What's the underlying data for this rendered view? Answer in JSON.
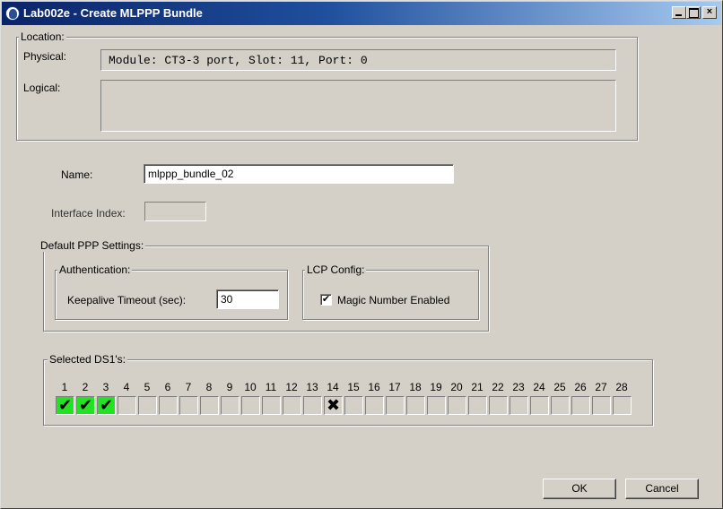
{
  "window": {
    "title": "Lab002e - Create MLPPP Bundle",
    "controls": {
      "minimize": "",
      "maximize": "",
      "close": "×"
    }
  },
  "location": {
    "group_label": "Location:",
    "physical_label": "Physical:",
    "physical_value": "Module: CT3-3 port, Slot: 11, Port: 0",
    "logical_label": "Logical:",
    "logical_value": ""
  },
  "form": {
    "name_label": "Name:",
    "name_value": "mlppp_bundle_02",
    "interface_index_label": "Interface Index:",
    "interface_index_value": ""
  },
  "ppp": {
    "group_label": "Default PPP Settings:",
    "auth": {
      "group_label": "Authentication:",
      "keepalive_label": "Keepalive Timeout (sec):",
      "keepalive_value": "30"
    },
    "lcp": {
      "group_label": "LCP Config:",
      "magic_label": "Magic Number Enabled",
      "magic_mark": "✔",
      "magic_checked": true
    }
  },
  "ds1": {
    "group_label": "Selected DS1's:",
    "channels": [
      {
        "num": "1",
        "state": "selected",
        "mark": "✔"
      },
      {
        "num": "2",
        "state": "selected",
        "mark": "✔"
      },
      {
        "num": "3",
        "state": "selected",
        "mark": "✔"
      },
      {
        "num": "4",
        "state": "empty",
        "mark": ""
      },
      {
        "num": "5",
        "state": "empty",
        "mark": ""
      },
      {
        "num": "6",
        "state": "empty",
        "mark": ""
      },
      {
        "num": "7",
        "state": "empty",
        "mark": ""
      },
      {
        "num": "8",
        "state": "empty",
        "mark": ""
      },
      {
        "num": "9",
        "state": "empty",
        "mark": ""
      },
      {
        "num": "10",
        "state": "empty",
        "mark": ""
      },
      {
        "num": "11",
        "state": "empty",
        "mark": ""
      },
      {
        "num": "12",
        "state": "empty",
        "mark": ""
      },
      {
        "num": "13",
        "state": "empty",
        "mark": ""
      },
      {
        "num": "14",
        "state": "unavailable",
        "mark": "✖"
      },
      {
        "num": "15",
        "state": "empty",
        "mark": ""
      },
      {
        "num": "16",
        "state": "empty",
        "mark": ""
      },
      {
        "num": "17",
        "state": "empty",
        "mark": ""
      },
      {
        "num": "18",
        "state": "empty",
        "mark": ""
      },
      {
        "num": "19",
        "state": "empty",
        "mark": ""
      },
      {
        "num": "20",
        "state": "empty",
        "mark": ""
      },
      {
        "num": "21",
        "state": "empty",
        "mark": ""
      },
      {
        "num": "22",
        "state": "empty",
        "mark": ""
      },
      {
        "num": "23",
        "state": "empty",
        "mark": ""
      },
      {
        "num": "24",
        "state": "empty",
        "mark": ""
      },
      {
        "num": "25",
        "state": "empty",
        "mark": ""
      },
      {
        "num": "26",
        "state": "empty",
        "mark": ""
      },
      {
        "num": "27",
        "state": "empty",
        "mark": ""
      },
      {
        "num": "28",
        "state": "empty",
        "mark": ""
      }
    ]
  },
  "buttons": {
    "ok": "OK",
    "cancel": "Cancel"
  },
  "colors": {
    "selected": "#22e222",
    "titlebar": "#0a246a",
    "face": "#d4d0c8"
  }
}
